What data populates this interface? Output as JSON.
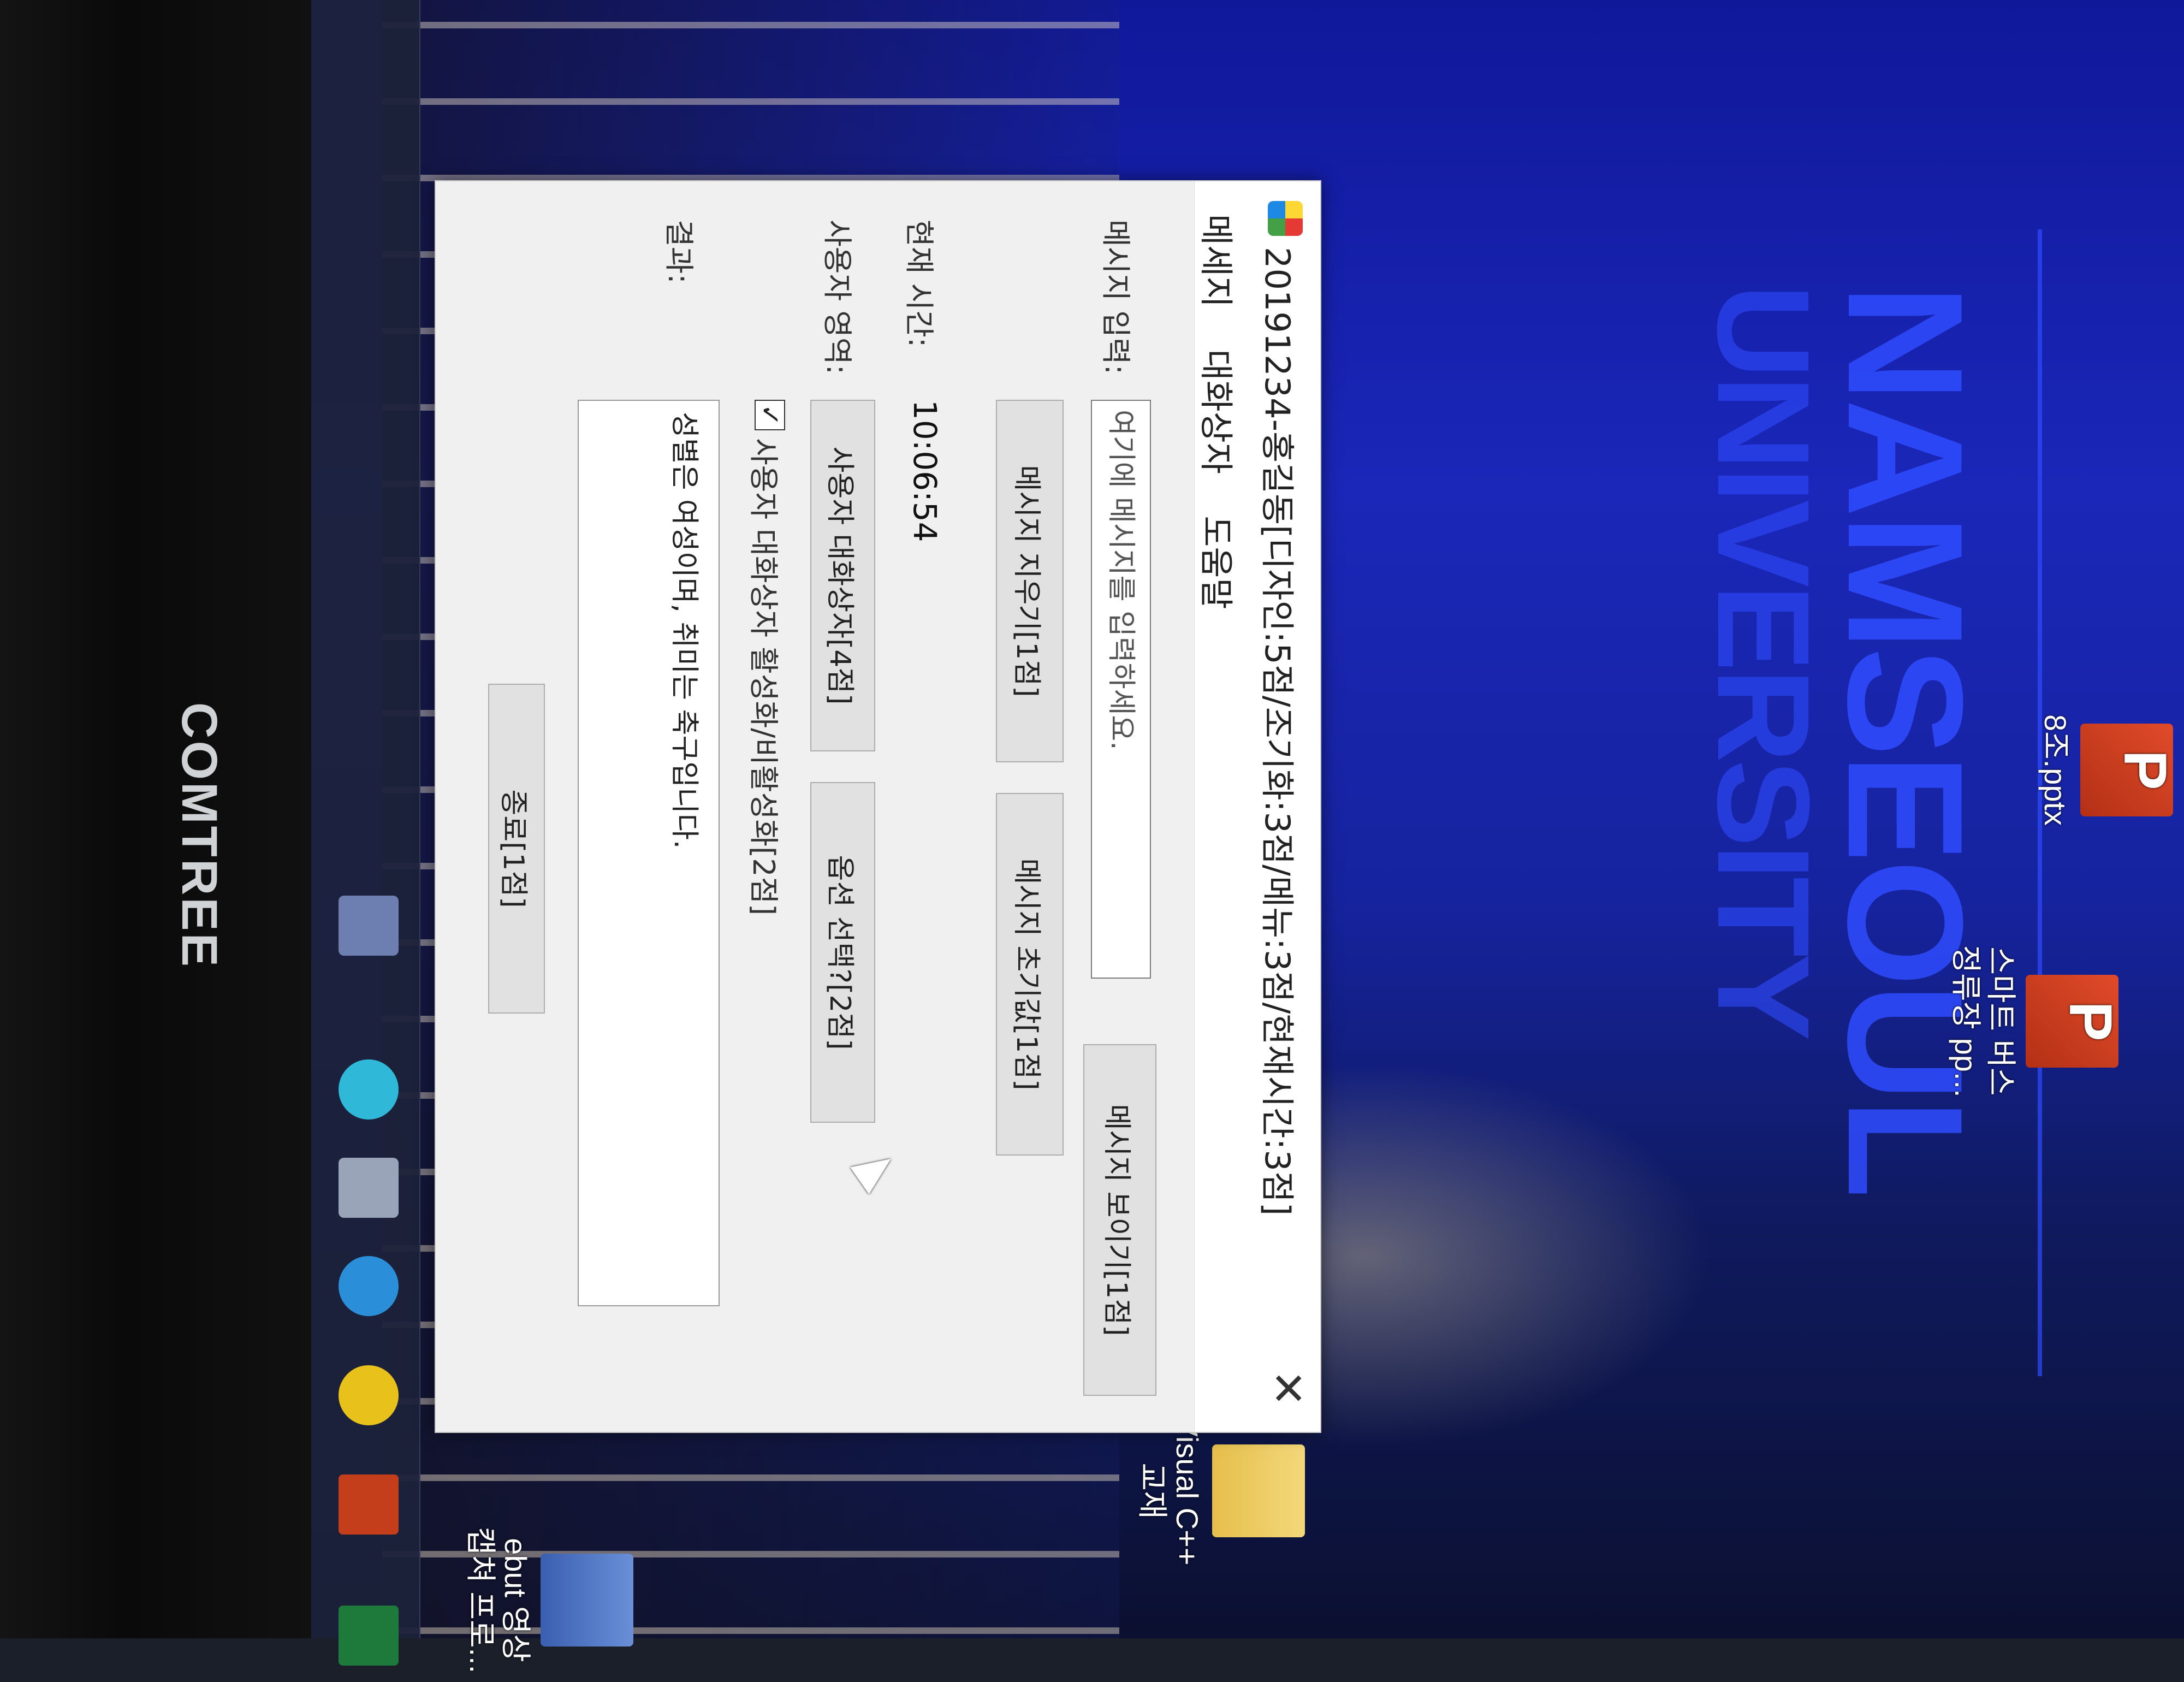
{
  "desktop": {
    "background_text_line1": "NAMSEOUL",
    "background_text_line2": "UNIVERSITY",
    "icons": [
      {
        "name": "스마트 버스\n정류장 pp..."
      },
      {
        "name": "8조.pptx"
      },
      {
        "name": "Visual C++\n교재"
      },
      {
        "name": "ebut 영상\n캡쳐 프로..."
      }
    ]
  },
  "monitor": {
    "brand": "COMTREE"
  },
  "dialog": {
    "title": "20191234-홍길동[디자인:5점/조기화:3점/메뉴:3점/현재시간:3점]",
    "close_label": "✕",
    "menu": [
      "메세지",
      "대화상자",
      "도움말"
    ],
    "message_label": "메시지 입력:",
    "message_value": "여기에 메시지를 입력하세요.",
    "btn_show": "메시지 보이기[1점]",
    "btn_clear": "메시지 지우기[1점]",
    "btn_reset": "메시지 초기값[1점]",
    "time_label": "현재 시간:",
    "time_value": "10:06:54",
    "user_area_label": "사용자 영역:",
    "btn_user_dialog": "사용자 대화상자[4점]",
    "btn_option": "옵션 선택?[2점]",
    "checkbox_checked": true,
    "checkbox_label": "사용자 대화상자 활성화/비활성화[2점]",
    "result_label": "결과:",
    "result_value": "성별은 여성이며, 취미는 축구입니다.",
    "btn_exit": "종료[1점]"
  }
}
